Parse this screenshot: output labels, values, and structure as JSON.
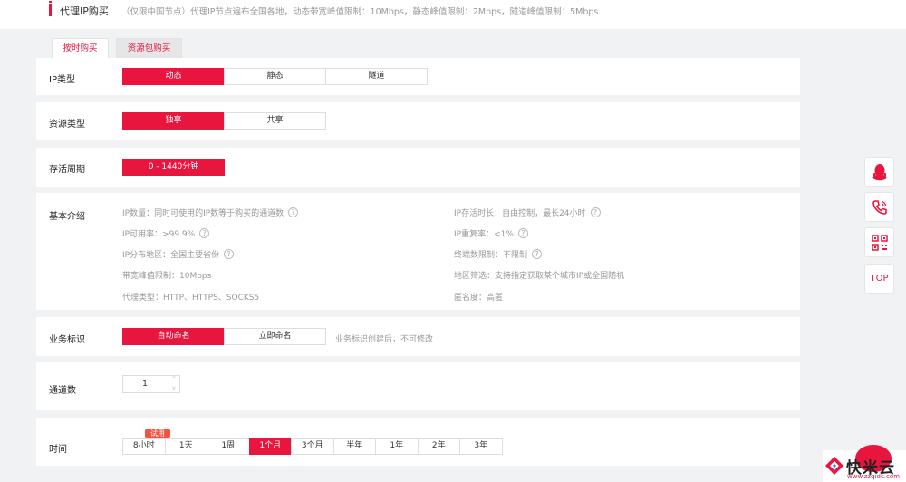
{
  "header": {
    "title": "代理IP购买",
    "description": "（仅限中国节点）代理IP节点遍布全国各地，动态带宽峰值限制：10Mbps，静态峰值限制：2Mbps，隧道峰值限制：5Mbps"
  },
  "tabs": [
    {
      "label": "按时购买",
      "active": true
    },
    {
      "label": "资源包购买",
      "active": false
    }
  ],
  "ip_type": {
    "label": "IP类型",
    "options": [
      "动态",
      "静态",
      "隧道"
    ],
    "selected": "动态"
  },
  "resource_type": {
    "label": "资源类型",
    "options": [
      "独享",
      "共享"
    ],
    "selected": "独享"
  },
  "lifetime": {
    "label": "存活周期",
    "options": [
      "0 - 1440分钟"
    ],
    "selected": "0 - 1440分钟"
  },
  "intro": {
    "label": "基本介绍",
    "left": [
      {
        "text": "IP数量：同时可使用的IP数等于购买的通道数",
        "help": "?"
      },
      {
        "text": "IP可用率：>99.9%",
        "help": "?"
      },
      {
        "text": "IP分布地区：全国主要省份",
        "help": "?"
      },
      {
        "text": "带宽峰值限制：10Mbps",
        "help": ""
      },
      {
        "text": "代理类型：HTTP、HTTPS、SOCKS5",
        "help": ""
      }
    ],
    "right": [
      {
        "text": "IP存活时长：自由控制，最长24小时",
        "help": "?"
      },
      {
        "text": "IP重复率：<1%",
        "help": "?"
      },
      {
        "text": "终端数限制：不限制",
        "help": "?"
      },
      {
        "text": "地区筛选：支持指定获取某个城市IP或全国随机",
        "help": ""
      },
      {
        "text": "匿名度：高匿",
        "help": ""
      }
    ]
  },
  "business_id": {
    "label": "业务标识",
    "options": [
      "自动命名",
      "立即命名"
    ],
    "selected": "自动命名",
    "hint": "业务标识创建后，不可修改"
  },
  "channels": {
    "label": "通道数",
    "value": "1",
    "up_icon": "^",
    "down_icon": "v"
  },
  "duration": {
    "label": "时间",
    "badge": "试用",
    "options": [
      "8小时",
      "1天",
      "1周",
      "1个月",
      "3个月",
      "半年",
      "1年",
      "2年",
      "3年"
    ],
    "selected": "1个月"
  },
  "float_bar": {
    "top_label": "TOP"
  },
  "watermark": {
    "name": "快米云",
    "url": "www.zzqidc.com"
  },
  "colors": {
    "accent": "#e8163e"
  }
}
